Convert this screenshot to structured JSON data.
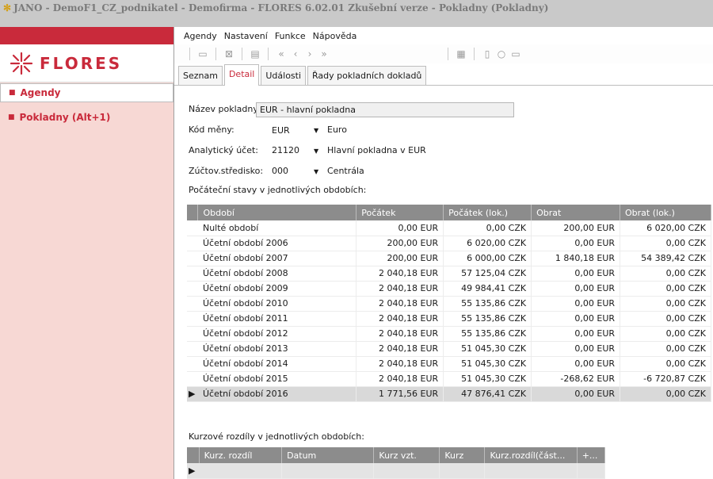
{
  "window": {
    "title": "JANO - DemoF1_CZ_podnikatel - Demofirma - FLORES 6.02.01 Zkušební verze - Pokladny (Pokladny)",
    "app_icon": "flores-flower-icon"
  },
  "sidebar": {
    "brand": "FLORES",
    "items": [
      {
        "label": "Agendy",
        "icon": "square-bullet-icon"
      },
      {
        "label": "Pokladny (Alt+1)",
        "icon": "square-bullet-icon"
      }
    ]
  },
  "menu": {
    "items": [
      {
        "label": "Agendy"
      },
      {
        "label": "Nastavení"
      },
      {
        "label": "Funkce"
      },
      {
        "label": "Nápověda"
      }
    ]
  },
  "toolbar": {
    "icons": [
      "folder-icon",
      "close-box-icon",
      "grid-icon",
      "first-icon",
      "prev-icon",
      "next-icon",
      "last-icon",
      "form-icon",
      "doc-icon",
      "search-icon",
      "copy-icon"
    ]
  },
  "tabs": [
    {
      "label": "Seznam",
      "active": false
    },
    {
      "label": "Detail",
      "active": true
    },
    {
      "label": "Události",
      "active": false
    },
    {
      "label": "Řady pokladních dokladů",
      "active": false
    }
  ],
  "form": {
    "nazev_label": "Název pokladny:",
    "nazev_value": "EUR - hlavní pokladna",
    "kod_label": "Kód měny:",
    "kod_value": "EUR",
    "kod_desc": "Euro",
    "ucet_label": "Analytický účet:",
    "ucet_value": "21120",
    "ucet_desc": "Hlavní pokladna v EUR",
    "stredisko_label": "Zúčtov.středisko:",
    "stredisko_value": "000",
    "stredisko_desc": "Centrála"
  },
  "balances": {
    "section_label": "Počáteční stavy v jednotlivých obdobích:",
    "columns": [
      "Období",
      "Počátek",
      "Počátek (lok.)",
      "Obrat",
      "Obrat (lok.)"
    ],
    "rows": [
      [
        "Nulté období",
        "0,00 EUR",
        "0,00 CZK",
        "200,00 EUR",
        "6 020,00 CZK"
      ],
      [
        "Účetní období 2006",
        "200,00 EUR",
        "6 020,00 CZK",
        "0,00 EUR",
        "0,00 CZK"
      ],
      [
        "Účetní období 2007",
        "200,00 EUR",
        "6 000,00 CZK",
        "1 840,18 EUR",
        "54 389,42 CZK"
      ],
      [
        "Účetní období 2008",
        "2 040,18 EUR",
        "57 125,04 CZK",
        "0,00 EUR",
        "0,00 CZK"
      ],
      [
        "Účetní období 2009",
        "2 040,18 EUR",
        "49 984,41 CZK",
        "0,00 EUR",
        "0,00 CZK"
      ],
      [
        "Účetní období 2010",
        "2 040,18 EUR",
        "55 135,86 CZK",
        "0,00 EUR",
        "0,00 CZK"
      ],
      [
        "Účetní období 2011",
        "2 040,18 EUR",
        "55 135,86 CZK",
        "0,00 EUR",
        "0,00 CZK"
      ],
      [
        "Účetní období 2012",
        "2 040,18 EUR",
        "55 135,86 CZK",
        "0,00 EUR",
        "0,00 CZK"
      ],
      [
        "Účetní období 2013",
        "2 040,18 EUR",
        "51 045,30 CZK",
        "0,00 EUR",
        "0,00 CZK"
      ],
      [
        "Účetní období 2014",
        "2 040,18 EUR",
        "51 045,30 CZK",
        "0,00 EUR",
        "0,00 CZK"
      ],
      [
        "Účetní období 2015",
        "2 040,18 EUR",
        "51 045,30 CZK",
        "-268,62 EUR",
        "-6 720,87 CZK"
      ],
      [
        "Účetní období 2016",
        "1 771,56 EUR",
        "47 876,41 CZK",
        "0,00 EUR",
        "0,00 CZK"
      ]
    ],
    "selected_row": 11
  },
  "fx": {
    "section_label": "Kurzové rozdíly v jednotlivých obdobích:",
    "columns": [
      "Kurz. rozdíl",
      "Datum",
      "Kurz vzt.",
      "Kurz",
      "Kurz.rozdíl(část...",
      "+..."
    ]
  }
}
